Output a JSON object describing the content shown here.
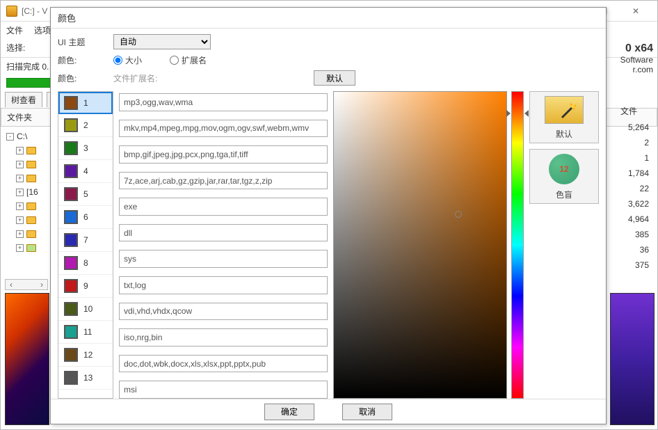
{
  "bg": {
    "title": "[C:] - V",
    "menu": {
      "file": "文件",
      "options": "选项"
    },
    "toolbar": {
      "select": "选择:"
    },
    "scan": {
      "label": "扫描完成 0."
    },
    "tabs": {
      "tree": "树查看",
      "file": "文"
    },
    "tree_header": "文件夹",
    "tree": {
      "root": "C:\\",
      "bracket": "[16"
    },
    "right": {
      "version": "0 x64",
      "software": "Software",
      "site": "r.com",
      "files_hdr": "文件",
      "vals": [
        "5,264",
        "2",
        "1",
        "1,784",
        "22",
        "3,622",
        "4,964",
        "385",
        "36",
        "375"
      ]
    },
    "win": {
      "min": "—",
      "max": "☐",
      "close": "✕"
    }
  },
  "dlg": {
    "title": "颜色",
    "ui_theme_label": "UI 主题",
    "ui_theme_value": "自动",
    "color_label": "颜色:",
    "radio_size": "大小",
    "radio_ext": "扩展名",
    "color_label2": "颜色:",
    "ext_label": "文件扩展名:",
    "default_btn": "默认",
    "colors": [
      {
        "n": "1",
        "hex": "#8a4a12"
      },
      {
        "n": "2",
        "hex": "#9a9a12"
      },
      {
        "n": "3",
        "hex": "#1a7a1a"
      },
      {
        "n": "4",
        "hex": "#5a1aa0"
      },
      {
        "n": "5",
        "hex": "#8a1a4a"
      },
      {
        "n": "6",
        "hex": "#1a6ad6"
      },
      {
        "n": "7",
        "hex": "#2a2ab0"
      },
      {
        "n": "8",
        "hex": "#b01ab0"
      },
      {
        "n": "9",
        "hex": "#c01a1a"
      },
      {
        "n": "10",
        "hex": "#4a5a1a"
      },
      {
        "n": "11",
        "hex": "#1aa090"
      },
      {
        "n": "12",
        "hex": "#6a4a1a"
      },
      {
        "n": "13",
        "hex": "#555555"
      }
    ],
    "exts": [
      "mp3,ogg,wav,wma",
      "mkv,mp4,mpeg,mpg,mov,ogm,ogv,swf,webm,wmv",
      "bmp,gif,jpeg,jpg,pcx,png,tga,tif,tiff",
      "7z,ace,arj,cab,gz,gzip,jar,rar,tar,tgz,z,zip",
      "exe",
      "dll",
      "sys",
      "txt,log",
      "vdi,vhd,vhdx,qcow",
      "iso,nrg,bin",
      "doc,dot,wbk,docx,xls,xlsx,ppt,pptx,pub",
      "msi"
    ],
    "presets": {
      "default": "默认",
      "colorblind": "色盲",
      "cb_num": "12"
    },
    "ok": "确定",
    "cancel": "取消"
  }
}
